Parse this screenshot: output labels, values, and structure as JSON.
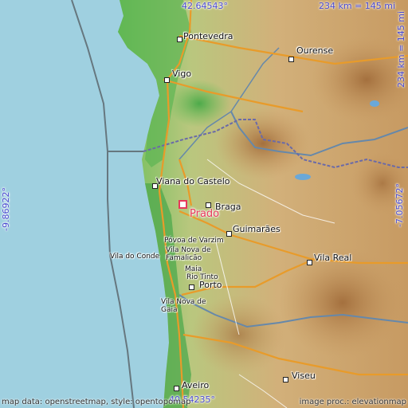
{
  "map": {
    "place": "Prado",
    "coords": {
      "top": "42.64543°",
      "bottom": "40.54235°",
      "left": "-9.86922°",
      "right": "-7.05672°"
    },
    "scale_top": "234 km = 145 mi",
    "scale_right": "234 km = 145 mi",
    "cities": [
      {
        "name": "Pontevedra"
      },
      {
        "name": "Ourense"
      },
      {
        "name": "Vigo"
      },
      {
        "name": "Viana do Castelo"
      },
      {
        "name": "Braga"
      },
      {
        "name": "Guimarães"
      },
      {
        "name": "Póvoa de Varzim"
      },
      {
        "name": "Vila Nova de Famalicão"
      },
      {
        "name": "Vila do Conde"
      },
      {
        "name": "Vila Real"
      },
      {
        "name": "Maia"
      },
      {
        "name": "Rio Tinto"
      },
      {
        "name": "Porto"
      },
      {
        "name": "Vila Nova de Gaia"
      },
      {
        "name": "Viseu"
      },
      {
        "name": "Aveiro"
      }
    ],
    "footer_left": "map data: openstreetmap, style: opentopomap",
    "footer_right": "image proc.: elevationmap",
    "colors": {
      "sea": "#9fd0e0",
      "coord_text": "#4a4ad0",
      "marker": "#e8385b"
    }
  }
}
